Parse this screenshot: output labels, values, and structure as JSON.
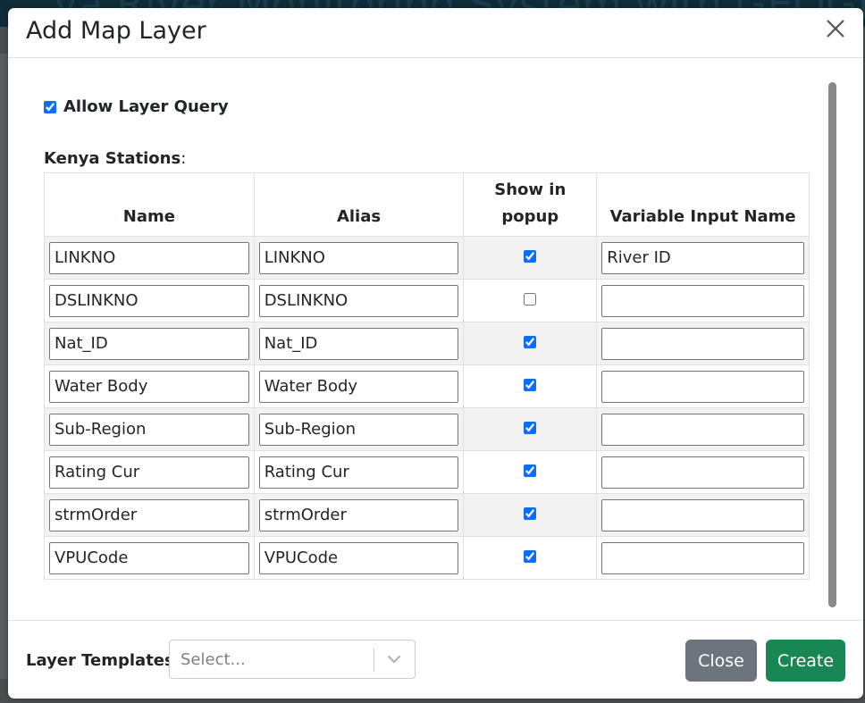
{
  "background": {
    "title_fragment": "ya River Monitoring System with GEOGL"
  },
  "modal": {
    "title": "Add Map Layer",
    "close_icon": "close-icon"
  },
  "query": {
    "allow_label": "Allow Layer Query",
    "allow_checked": true
  },
  "section": {
    "label": "Kenya Stations",
    "colon": ":"
  },
  "table": {
    "headers": {
      "name": "Name",
      "alias": "Alias",
      "show_line1": "Show in",
      "show_line2": "popup",
      "variable": "Variable Input Name"
    },
    "rows": [
      {
        "name": "LINKNO",
        "alias": "LINKNO",
        "show": true,
        "variable": "River ID"
      },
      {
        "name": "DSLINKNO",
        "alias": "DSLINKNO",
        "show": false,
        "variable": ""
      },
      {
        "name": "Nat_ID",
        "alias": "Nat_ID",
        "show": true,
        "variable": ""
      },
      {
        "name": "Water Body",
        "alias": "Water Body",
        "show": true,
        "variable": ""
      },
      {
        "name": "Sub-Region",
        "alias": "Sub-Region",
        "show": true,
        "variable": ""
      },
      {
        "name": "Rating Cur",
        "alias": "Rating Cur",
        "show": true,
        "variable": ""
      },
      {
        "name": "strmOrder",
        "alias": "strmOrder",
        "show": true,
        "variable": ""
      },
      {
        "name": "VPUCode",
        "alias": "VPUCode",
        "show": true,
        "variable": ""
      }
    ]
  },
  "footer": {
    "templates_label": "Layer Templates",
    "select_placeholder": "Select...",
    "close_label": "Close",
    "create_label": "Create"
  },
  "colors": {
    "primary": "#0d6efd",
    "secondary": "#6c757d",
    "success": "#198754"
  }
}
